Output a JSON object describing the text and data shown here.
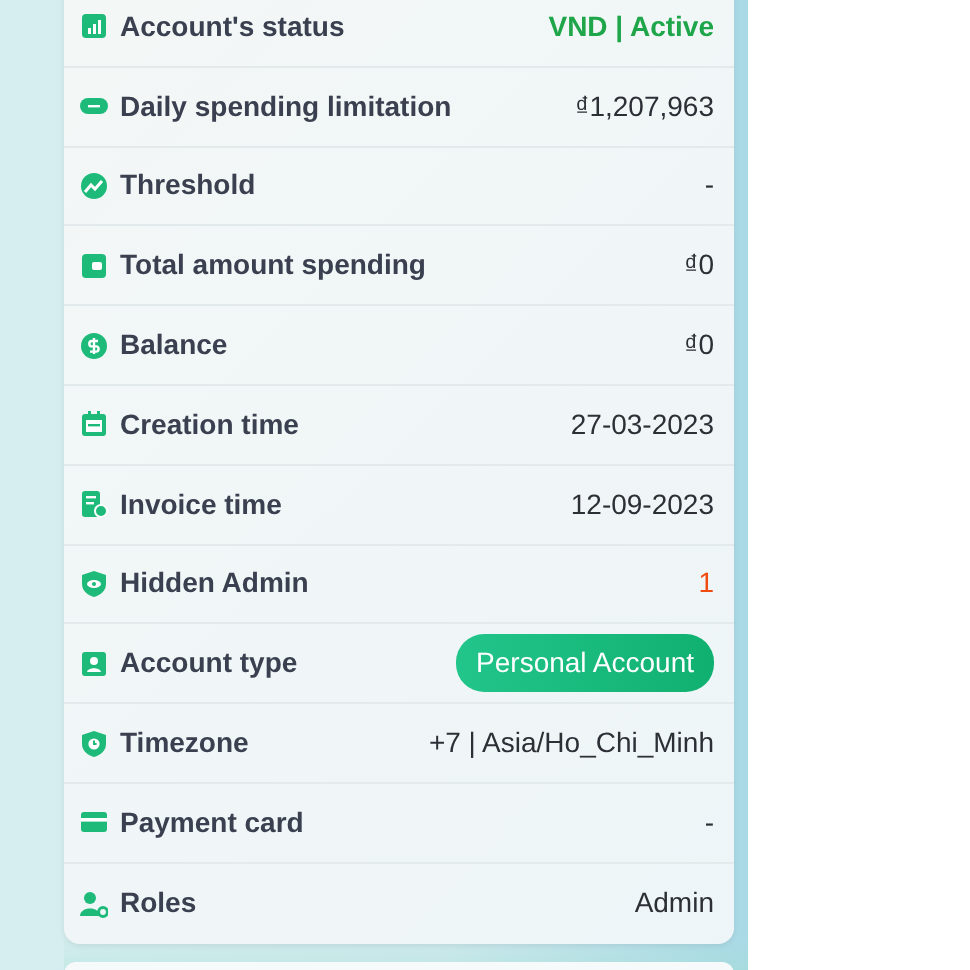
{
  "rows": [
    {
      "label": "Account's status",
      "value": "VND | Active",
      "kind": "status"
    },
    {
      "label": "Daily spending limitation",
      "value": "₫1,207,963",
      "kind": "text"
    },
    {
      "label": "Threshold",
      "value": "-",
      "kind": "text"
    },
    {
      "label": "Total amount spending",
      "value": "₫0",
      "kind": "text"
    },
    {
      "label": "Balance",
      "value": "₫0",
      "kind": "text"
    },
    {
      "label": "Creation time",
      "value": "27-03-2023",
      "kind": "text"
    },
    {
      "label": "Invoice time",
      "value": "12-09-2023",
      "kind": "text"
    },
    {
      "label": "Hidden Admin",
      "value": "1",
      "kind": "alert"
    },
    {
      "label": "Account type",
      "value": "Personal Account",
      "kind": "badge"
    },
    {
      "label": "Timezone",
      "value": "+7 | Asia/Ho_Chi_Minh",
      "kind": "text"
    },
    {
      "label": "Payment card",
      "value": "-",
      "kind": "text"
    },
    {
      "label": "Roles",
      "value": "Admin",
      "kind": "text"
    }
  ]
}
